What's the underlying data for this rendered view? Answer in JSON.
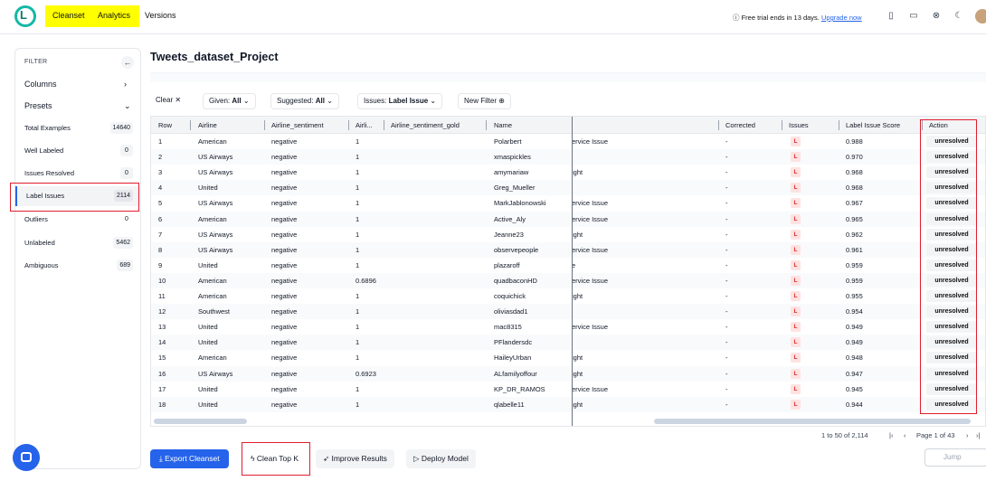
{
  "nav": {
    "cleanset": "Cleanset",
    "analytics": "Analytics",
    "versions": "Versions",
    "logo_letter": "L"
  },
  "trial": {
    "text": "Free trial ends in 13 days.",
    "link": "Upgrade now"
  },
  "sidebar": {
    "filter_title": "FILTER",
    "columns_label": "Columns",
    "presets_label": "Presets",
    "items": [
      {
        "label": "Total Examples",
        "count": "14640"
      },
      {
        "label": "Well Labeled",
        "count": "0"
      },
      {
        "label": "Issues Resolved",
        "count": "0"
      },
      {
        "label": "Label Issues",
        "count": "2114"
      },
      {
        "label": "Outliers",
        "count": "0"
      },
      {
        "label": "Unlabeled",
        "count": "5462"
      },
      {
        "label": "Ambiguous",
        "count": "689"
      }
    ]
  },
  "page_title": "Tweets_dataset_Project",
  "filters": {
    "clear": "Clear",
    "given_label": "Given:",
    "given_value": "All",
    "suggested_label": "Suggested:",
    "suggested_value": "All",
    "issues_label": "Issues:",
    "issues_value": "Label Issue",
    "new_filter": "New Filter"
  },
  "table": {
    "headers": [
      "Row",
      "Airline",
      "Airline_sentiment",
      "Airli...",
      "Airline_sentiment_gold",
      "Name",
      "Corrected",
      "Issues",
      "Label Issue Score",
      "Action"
    ],
    "rows": [
      {
        "row": "1",
        "airline": "American",
        "sentiment": "negative",
        "conf": "1",
        "name": "Polarbert",
        "reason": "ervice Issue",
        "corrected": "-",
        "issue": "L",
        "score": "0.988",
        "action": "unresolved"
      },
      {
        "row": "2",
        "airline": "US Airways",
        "sentiment": "negative",
        "conf": "1",
        "name": "xmaspickles",
        "reason": "",
        "corrected": "-",
        "issue": "L",
        "score": "0.970",
        "action": "unresolved"
      },
      {
        "row": "3",
        "airline": "US Airways",
        "sentiment": "negative",
        "conf": "1",
        "name": "amymariaw",
        "reason": "ight",
        "corrected": "-",
        "issue": "L",
        "score": "0.968",
        "action": "unresolved"
      },
      {
        "row": "4",
        "airline": "United",
        "sentiment": "negative",
        "conf": "1",
        "name": "Greg_Mueller",
        "reason": "",
        "corrected": "-",
        "issue": "L",
        "score": "0.968",
        "action": "unresolved"
      },
      {
        "row": "5",
        "airline": "US Airways",
        "sentiment": "negative",
        "conf": "1",
        "name": "MarkJablonowski",
        "reason": "ervice Issue",
        "corrected": "-",
        "issue": "L",
        "score": "0.967",
        "action": "unresolved"
      },
      {
        "row": "6",
        "airline": "American",
        "sentiment": "negative",
        "conf": "1",
        "name": "Active_Aly",
        "reason": "ervice Issue",
        "corrected": "-",
        "issue": "L",
        "score": "0.965",
        "action": "unresolved"
      },
      {
        "row": "7",
        "airline": "US Airways",
        "sentiment": "negative",
        "conf": "1",
        "name": "Jeanne23",
        "reason": "ight",
        "corrected": "-",
        "issue": "L",
        "score": "0.962",
        "action": "unresolved"
      },
      {
        "row": "8",
        "airline": "US Airways",
        "sentiment": "negative",
        "conf": "1",
        "name": "observepeople",
        "reason": "ervice Issue",
        "corrected": "-",
        "issue": "L",
        "score": "0.961",
        "action": "unresolved"
      },
      {
        "row": "9",
        "airline": "United",
        "sentiment": "negative",
        "conf": "1",
        "name": "plazaroff",
        "reason": "e",
        "corrected": "-",
        "issue": "L",
        "score": "0.959",
        "action": "unresolved"
      },
      {
        "row": "10",
        "airline": "American",
        "sentiment": "negative",
        "conf": "0.6896",
        "name": "quadbaconHD",
        "reason": "ervice Issue",
        "corrected": "-",
        "issue": "L",
        "score": "0.959",
        "action": "unresolved"
      },
      {
        "row": "11",
        "airline": "American",
        "sentiment": "negative",
        "conf": "1",
        "name": "coquichick",
        "reason": "ight",
        "corrected": "-",
        "issue": "L",
        "score": "0.955",
        "action": "unresolved"
      },
      {
        "row": "12",
        "airline": "Southwest",
        "sentiment": "negative",
        "conf": "1",
        "name": "oliviasdad1",
        "reason": "",
        "corrected": "-",
        "issue": "L",
        "score": "0.954",
        "action": "unresolved"
      },
      {
        "row": "13",
        "airline": "United",
        "sentiment": "negative",
        "conf": "1",
        "name": "mac8315",
        "reason": "ervice Issue",
        "corrected": "-",
        "issue": "L",
        "score": "0.949",
        "action": "unresolved"
      },
      {
        "row": "14",
        "airline": "United",
        "sentiment": "negative",
        "conf": "1",
        "name": "PFlandersdc",
        "reason": "",
        "corrected": "-",
        "issue": "L",
        "score": "0.949",
        "action": "unresolved"
      },
      {
        "row": "15",
        "airline": "American",
        "sentiment": "negative",
        "conf": "1",
        "name": "HaileyUrban",
        "reason": "ight",
        "corrected": "-",
        "issue": "L",
        "score": "0.948",
        "action": "unresolved"
      },
      {
        "row": "16",
        "airline": "US Airways",
        "sentiment": "negative",
        "conf": "0.6923",
        "name": "ALfamilyoffour",
        "reason": "ight",
        "corrected": "-",
        "issue": "L",
        "score": "0.947",
        "action": "unresolved"
      },
      {
        "row": "17",
        "airline": "United",
        "sentiment": "negative",
        "conf": "1",
        "name": "KP_DR_RAMOS",
        "reason": "ervice Issue",
        "corrected": "-",
        "issue": "L",
        "score": "0.945",
        "action": "unresolved"
      },
      {
        "row": "18",
        "airline": "United",
        "sentiment": "negative",
        "conf": "1",
        "name": "qlabelle11",
        "reason": "ight",
        "corrected": "-",
        "issue": "L",
        "score": "0.944",
        "action": "unresolved"
      }
    ]
  },
  "pagination": {
    "range": "1 to 50 of 2,114",
    "page": "Page 1 of 43"
  },
  "actions": {
    "export": "Export Cleanset",
    "clean_top_k": "Clean Top K",
    "improve": "Improve Results",
    "deploy": "Deploy Model",
    "jump_placeholder": "Jump"
  },
  "colors": {
    "primary": "#2563eb",
    "highlight": "#ffff00",
    "annotation_red": "#e11d2e",
    "issue_badge": "#dc2626"
  }
}
